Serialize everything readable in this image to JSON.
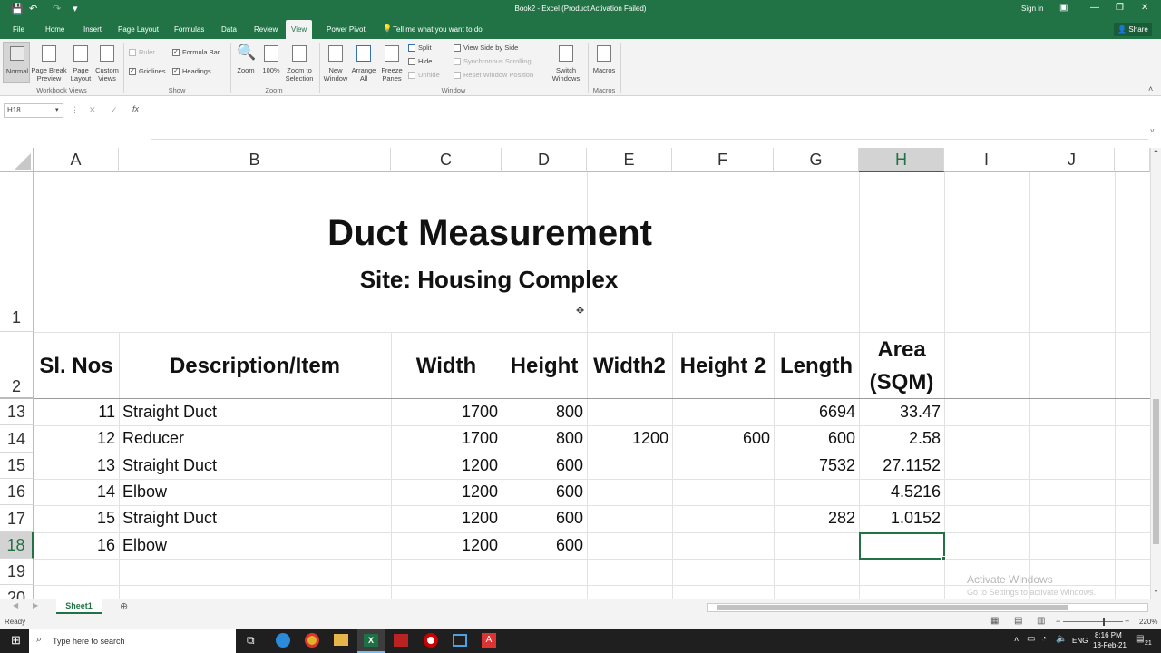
{
  "titlebar": {
    "title": "Book2 - Excel (Product Activation Failed)",
    "signin": "Sign in",
    "share": "Share"
  },
  "tabs": [
    "File",
    "Home",
    "Insert",
    "Page Layout",
    "Formulas",
    "Data",
    "Review",
    "View",
    "Power Pivot"
  ],
  "tell_me": "Tell me what you want to do",
  "ribbon": {
    "normal": "Normal",
    "page_break": "Page Break Preview",
    "page_layout": "Page Layout",
    "custom_views": "Custom Views",
    "group_workbook_views": "Workbook Views",
    "ruler": "Ruler",
    "formula_bar": "Formula Bar",
    "gridlines": "Gridlines",
    "headings": "Headings",
    "group_show": "Show",
    "zoom": "Zoom",
    "zoom100": "100%",
    "zoom_selection": "Zoom to Selection",
    "group_zoom": "Zoom",
    "new_window": "New Window",
    "arrange_all": "Arrange All",
    "freeze_panes": "Freeze Panes",
    "split": "Split",
    "hide": "Hide",
    "unhide": "Unhide",
    "view_side": "View Side by Side",
    "sync_scroll": "Synchronous Scrolling",
    "reset_window": "Reset Window Position",
    "switch_windows": "Switch Windows",
    "group_window": "Window",
    "macros": "Macros",
    "group_macros": "Macros"
  },
  "formula": {
    "namebox": "H18",
    "fx": "fx",
    "cancel": "✕",
    "enter": "✓"
  },
  "columns": [
    "A",
    "B",
    "C",
    "D",
    "E",
    "F",
    "G",
    "H",
    "I",
    "J"
  ],
  "sheet_title": "Duct Measurement",
  "sheet_subtitle": "Site: Housing Complex",
  "header_row": {
    "a": "Sl. Nos",
    "b": "Description/Item",
    "c": "Width",
    "d": "Height",
    "e": "Width2",
    "f": "Height 2",
    "g": "Length",
    "h1": "Area",
    "h2": "(SQM)"
  },
  "row_numbers": [
    "1",
    "2",
    "13",
    "14",
    "15",
    "16",
    "17",
    "18",
    "19",
    "20"
  ],
  "rows": [
    {
      "a": "11",
      "b": "Straight Duct",
      "c": "1700",
      "d": "800",
      "e": "",
      "f": "",
      "g": "6694",
      "h": "33.47"
    },
    {
      "a": "12",
      "b": "Reducer",
      "c": "1700",
      "d": "800",
      "e": "1200",
      "f": "600",
      "g": "600",
      "h": "2.58"
    },
    {
      "a": "13",
      "b": "Straight Duct",
      "c": "1200",
      "d": "600",
      "e": "",
      "f": "",
      "g": "7532",
      "h": "27.1152"
    },
    {
      "a": "14",
      "b": "Elbow",
      "c": "1200",
      "d": "600",
      "e": "",
      "f": "",
      "g": "",
      "h": "4.5216"
    },
    {
      "a": "15",
      "b": "Straight Duct",
      "c": "1200",
      "d": "600",
      "e": "",
      "f": "",
      "g": "282",
      "h": "1.0152"
    },
    {
      "a": "16",
      "b": "Elbow",
      "c": "1200",
      "d": "600",
      "e": "",
      "f": "",
      "g": "",
      "h": ""
    }
  ],
  "watermark": {
    "line1": "Activate Windows",
    "line2": "Go to Settings to activate Windows."
  },
  "sheet_tab": "Sheet1",
  "status": {
    "ready": "Ready",
    "zoom": "220%"
  },
  "taskbar": {
    "search": "Type here to search",
    "lang": "ENG",
    "time": "8:16 PM",
    "date": "18-Feb-21",
    "notif": "21"
  }
}
